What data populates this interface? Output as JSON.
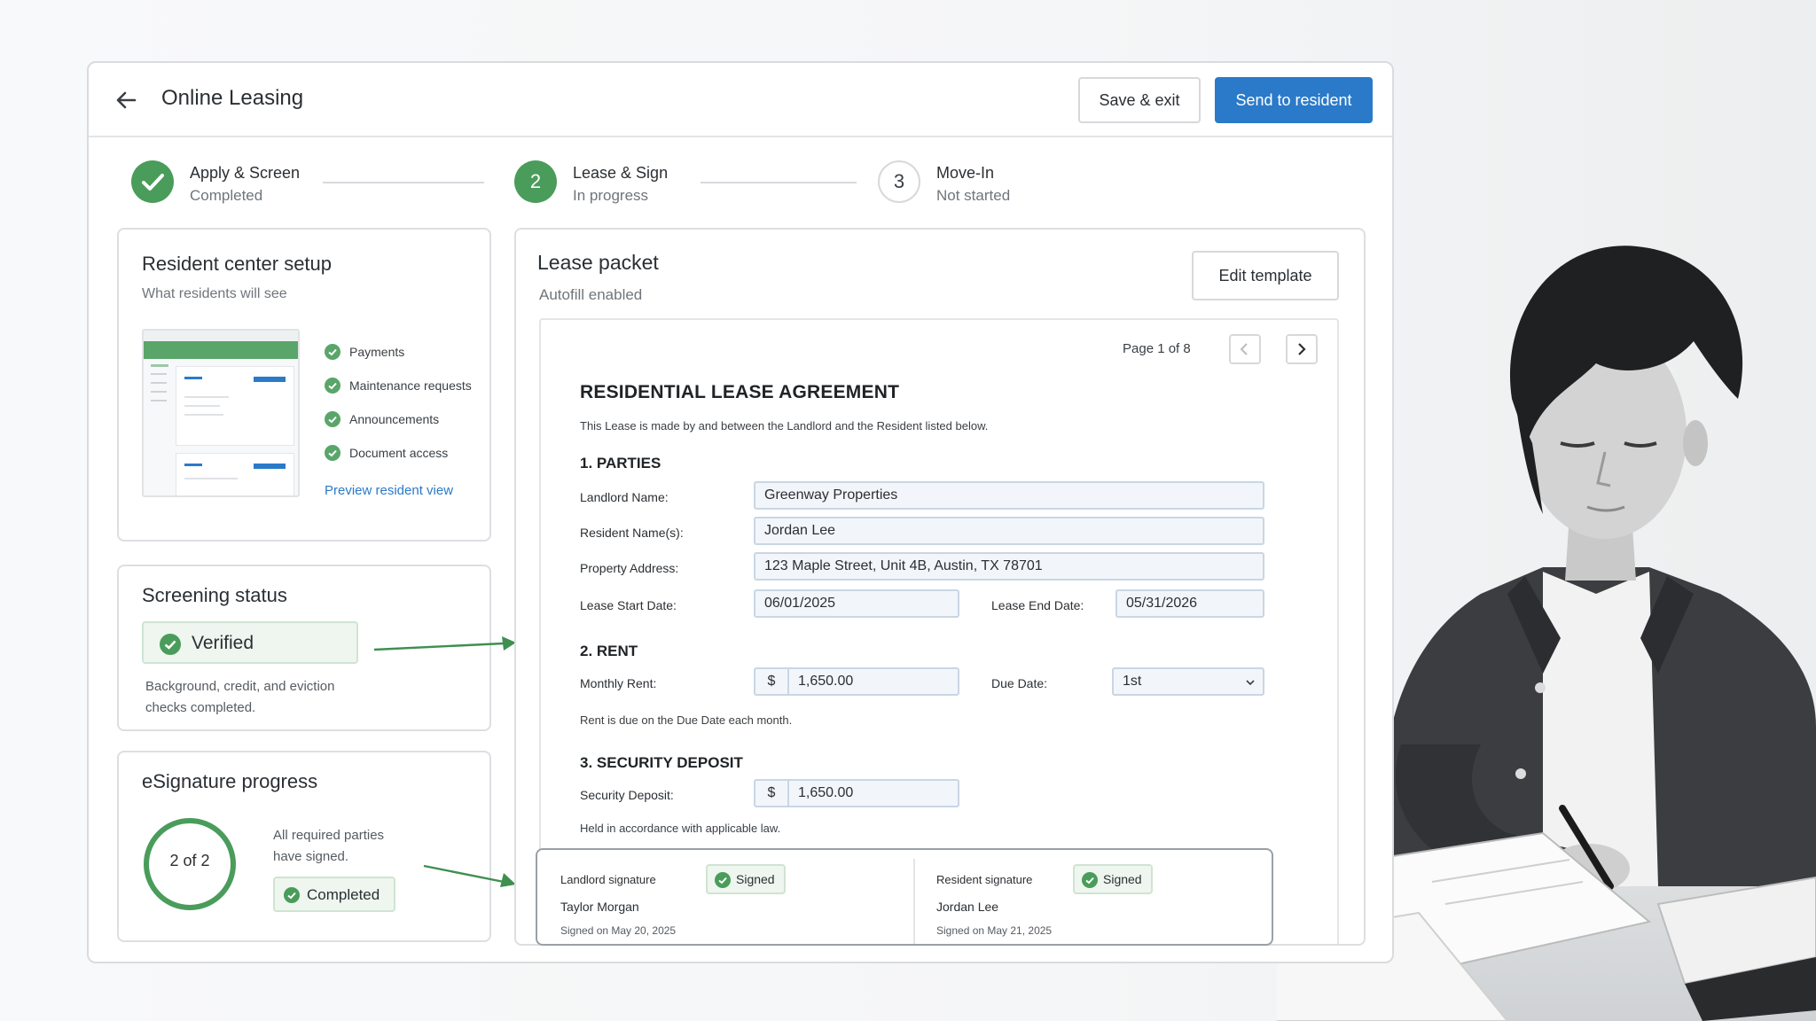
{
  "header": {
    "title": "Online Leasing",
    "save_label": "Save & exit",
    "send_label": "Send to resident"
  },
  "stepper": [
    {
      "number": "1",
      "title": "Apply & Screen",
      "status": "Completed",
      "state": "complete"
    },
    {
      "number": "2",
      "title": "Lease & Sign",
      "status": "In progress",
      "state": "active"
    },
    {
      "number": "3",
      "title": "Move-In",
      "status": "Not started",
      "state": "pending"
    }
  ],
  "resident_center": {
    "title": "Resident center setup",
    "subtitle": "What residents will see",
    "features": [
      "Payments",
      "Maintenance requests",
      "Announcements",
      "Document access"
    ],
    "preview_link": "Preview resident view"
  },
  "screening": {
    "title": "Screening status",
    "badge": "Verified",
    "description_line1": "Background, credit, and eviction",
    "description_line2": "checks completed."
  },
  "esignature": {
    "title": "eSignature progress",
    "progress_label": "2 of 2",
    "progress_fraction": 1.0,
    "message_line1": "All required parties",
    "message_line2": "have signed.",
    "badge": "Completed"
  },
  "packet": {
    "title": "Lease packet",
    "subtitle": "Autofill enabled",
    "edit_label": "Edit template",
    "page_indicator": "Page 1 of 8"
  },
  "document": {
    "heading": "RESIDENTIAL LEASE AGREEMENT",
    "intro": "This Lease is made by and between the Landlord and the Resident listed below.",
    "section1": "1. PARTIES",
    "landlord_label": "Landlord Name:",
    "landlord_value": "Greenway Properties",
    "resident_label": "Resident Name(s):",
    "resident_value": "Jordan Lee",
    "address_label": "Property Address:",
    "address_value": "123 Maple Street, Unit 4B, Austin, TX 78701",
    "start_label": "Lease Start Date:",
    "start_value": "06/01/2025",
    "end_label": "Lease End Date:",
    "end_value": "05/31/2026",
    "section2": "2. RENT",
    "rent_label": "Monthly Rent:",
    "currency": "$",
    "rent_value": "1,650.00",
    "due_label": "Due Date:",
    "due_value": "1st",
    "rent_note": "Rent is due on the Due Date each month.",
    "section3": "3. SECURITY DEPOSIT",
    "deposit_label": "Security Deposit:",
    "deposit_value": "1,650.00",
    "deposit_note": "Held in accordance with applicable law."
  },
  "signatures": [
    {
      "role": "Landlord signature",
      "status": "Signed",
      "name": "Taylor Morgan",
      "date": "Signed on May 20, 2025"
    },
    {
      "role": "Resident signature",
      "status": "Signed",
      "name": "Jordan Lee",
      "date": "Signed on May 21, 2025"
    }
  ],
  "colors": {
    "accent_blue": "#2a7ac9",
    "success_green": "#4a9c5b",
    "success_bg": "#eef6ef"
  }
}
